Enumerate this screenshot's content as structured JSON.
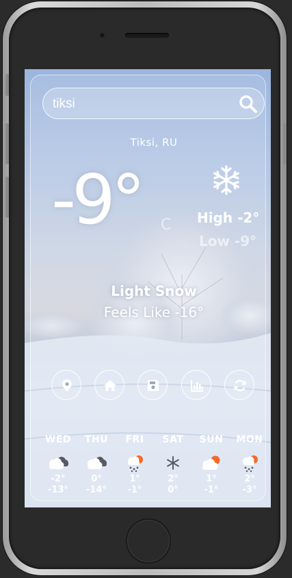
{
  "search": {
    "value": "tiksi"
  },
  "location": "Tiksi, RU",
  "current": {
    "temperature": "-9°",
    "unit": "C",
    "high": "High -2°",
    "low": "Low -9°",
    "description": "Light Snow",
    "feels_like": "Feels Like -16°",
    "icon": "snowflake-icon"
  },
  "actions": [
    {
      "icon": "location-pin-icon"
    },
    {
      "icon": "home-icon"
    },
    {
      "icon": "save-icon"
    },
    {
      "icon": "chart-icon"
    },
    {
      "icon": "refresh-icon"
    }
  ],
  "forecast": [
    {
      "day": "WED",
      "hi": "-2°",
      "lo": "-13°",
      "icon": "cloudy-icon"
    },
    {
      "day": "THU",
      "hi": "0°",
      "lo": "-14°",
      "icon": "cloudy-icon"
    },
    {
      "day": "FRI",
      "hi": "1°",
      "lo": "-1°",
      "icon": "snow-sun-cloud-icon"
    },
    {
      "day": "SAT",
      "hi": "2°",
      "lo": "0°",
      "icon": "snowflake-icon"
    },
    {
      "day": "SUN",
      "hi": "1°",
      "lo": "-1°",
      "icon": "partly-cloudy-icon"
    },
    {
      "day": "MON",
      "hi": "2°",
      "lo": "-3°",
      "icon": "snow-sun-cloud-icon"
    }
  ],
  "colors": {
    "accent": "#ffffff",
    "sun": "#f26b2a",
    "cloud": "#555a66"
  }
}
